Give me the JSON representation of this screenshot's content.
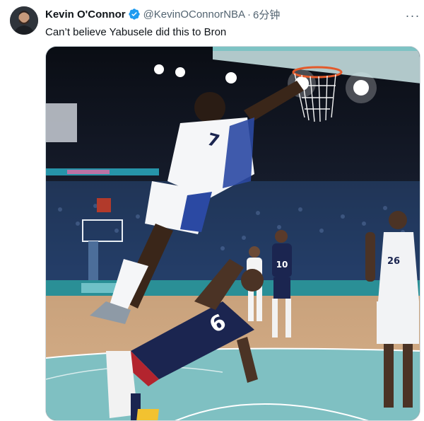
{
  "tweet": {
    "author_name": "Kevin O'Connor",
    "author_handle": "@KevinOConnorNBA",
    "separator": "·",
    "timestamp": "6分钟",
    "text": "Can’t believe Yabusele did this to Bron",
    "verified": true,
    "more_icon": "more-horizontal-icon"
  },
  "media": {
    "france_jersey_number": "7",
    "usa_jersey_number": "6",
    "background_usa_number": "10",
    "right_player_number": "26"
  },
  "colors": {
    "accent_blue": "#1d9bf0",
    "court_teal": "#8cc6c6",
    "usa_navy": "#1b2550"
  }
}
